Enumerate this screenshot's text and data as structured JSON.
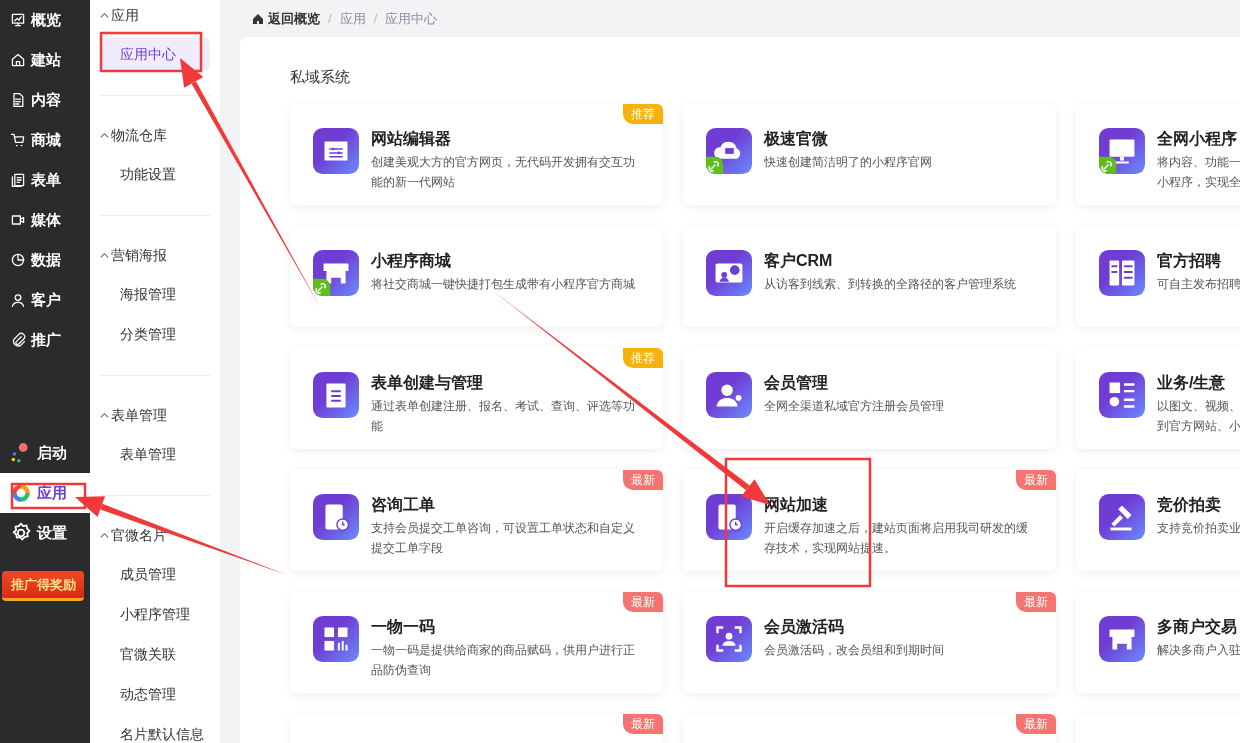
{
  "nav": [
    {
      "label": "概览",
      "selected": false
    },
    {
      "label": "建站",
      "selected": false
    },
    {
      "label": "内容",
      "selected": false
    },
    {
      "label": "商城",
      "selected": false
    },
    {
      "label": "表单",
      "selected": false
    },
    {
      "label": "媒体",
      "selected": false
    },
    {
      "label": "数据",
      "selected": false
    },
    {
      "label": "客户",
      "selected": false
    },
    {
      "label": "推广",
      "selected": false
    }
  ],
  "nav_bottom": [
    {
      "label": "启动",
      "selected": false
    },
    {
      "label": "应用",
      "selected": true
    },
    {
      "label": "设置",
      "selected": false
    }
  ],
  "promo": {
    "label": "推广得奖励"
  },
  "submenu": [
    {
      "title": "应用",
      "items": [
        {
          "label": "应用中心",
          "selected": true
        }
      ]
    },
    {
      "title": "物流仓库",
      "items": [
        {
          "label": "功能设置",
          "selected": false
        }
      ]
    },
    {
      "title": "营销海报",
      "items": [
        {
          "label": "海报管理",
          "selected": false
        },
        {
          "label": "分类管理",
          "selected": false
        }
      ]
    },
    {
      "title": "表单管理",
      "items": [
        {
          "label": "表单管理",
          "selected": false
        }
      ]
    },
    {
      "title": "官微名片",
      "items": [
        {
          "label": "成员管理",
          "selected": false
        },
        {
          "label": "小程序管理",
          "selected": false
        },
        {
          "label": "官微关联",
          "selected": false
        },
        {
          "label": "动态管理",
          "selected": false
        },
        {
          "label": "名片默认信息",
          "selected": false
        }
      ]
    }
  ],
  "breadcrumb": [
    {
      "kind": "home",
      "text": "返回概览"
    },
    {
      "kind": "separator",
      "text": "/"
    },
    {
      "kind": "link",
      "text": "应用"
    },
    {
      "kind": "separator",
      "text": "/"
    },
    {
      "kind": "link",
      "text": "应用中心"
    }
  ],
  "section_title": "私域系统",
  "cards": [
    {
      "title": "网站编辑器",
      "desc_lines": [
        "创建美观大方的官方网页，无代码开发拥有交互功",
        "能的新一代网站"
      ],
      "mini_program": false,
      "badge": {
        "kind": "recommended",
        "label": "推荐"
      }
    },
    {
      "title": "极速官微",
      "desc_lines": [
        "快速创建简洁明了的小程序官网"
      ],
      "mini_program": true
    },
    {
      "title": "全网小程序",
      "desc_lines": [
        "将内容、功能一",
        "小程序，实现全"
      ],
      "mini_program": true
    },
    {
      "title": "小程序商城",
      "desc_lines": [
        "将社交商城一键快捷打包生成带有小程序官方商城"
      ],
      "mini_program": true
    },
    {
      "title": "客户CRM",
      "desc_lines": [
        "从访客到线索、到转换的全路径的客户管理系统"
      ],
      "mini_program": false
    },
    {
      "title": "官方招聘",
      "desc_lines": [
        "可自主发布招聘"
      ],
      "mini_program": false
    },
    {
      "title": "表单创建与管理",
      "desc_lines": [
        "通过表单创建注册、报名、考试、查询、评选等功",
        "能"
      ],
      "mini_program": false,
      "badge": {
        "kind": "recommended",
        "label": "推荐"
      }
    },
    {
      "title": "会员管理",
      "desc_lines": [
        "全网全渠道私域官方注册会员管理"
      ],
      "mini_program": false
    },
    {
      "title": "业务/生意",
      "desc_lines": [
        "以图文、视频、",
        "到官方网站、小"
      ],
      "mini_program": false
    },
    {
      "title": "咨询工单",
      "desc_lines": [
        "支持会员提交工单咨询，可设置工单状态和自定义",
        "提交工单字段"
      ],
      "mini_program": false,
      "badge": {
        "kind": "new",
        "label": "最新"
      }
    },
    {
      "title": "网站加速",
      "desc_lines": [
        "开启缓存加速之后，建站页面将启用我司研发的缓",
        "存技术，实现网站提速。"
      ],
      "mini_program": false,
      "badge": {
        "kind": "new",
        "label": "最新"
      }
    },
    {
      "title": "竞价拍卖",
      "desc_lines": [
        "支持竞价拍卖业"
      ],
      "mini_program": false
    },
    {
      "title": "一物一码",
      "desc_lines": [
        "一物一码是提供给商家的商品赋码，供用户进行正",
        "品防伪查询"
      ],
      "mini_program": false,
      "badge": {
        "kind": "new",
        "label": "最新"
      }
    },
    {
      "title": "会员激活码",
      "desc_lines": [
        "会员激活码，改会员组和到期时间"
      ],
      "mini_program": false,
      "badge": {
        "kind": "new",
        "label": "最新"
      }
    },
    {
      "title": "多商户交易",
      "desc_lines": [
        "解决多商户入驻"
      ],
      "mini_program": false
    },
    {
      "kind": "blank",
      "badge": {
        "kind": "new",
        "label": "最新"
      }
    },
    {
      "kind": "blank",
      "badge": {
        "kind": "new",
        "label": "最新"
      }
    },
    {
      "kind": "blank"
    }
  ]
}
